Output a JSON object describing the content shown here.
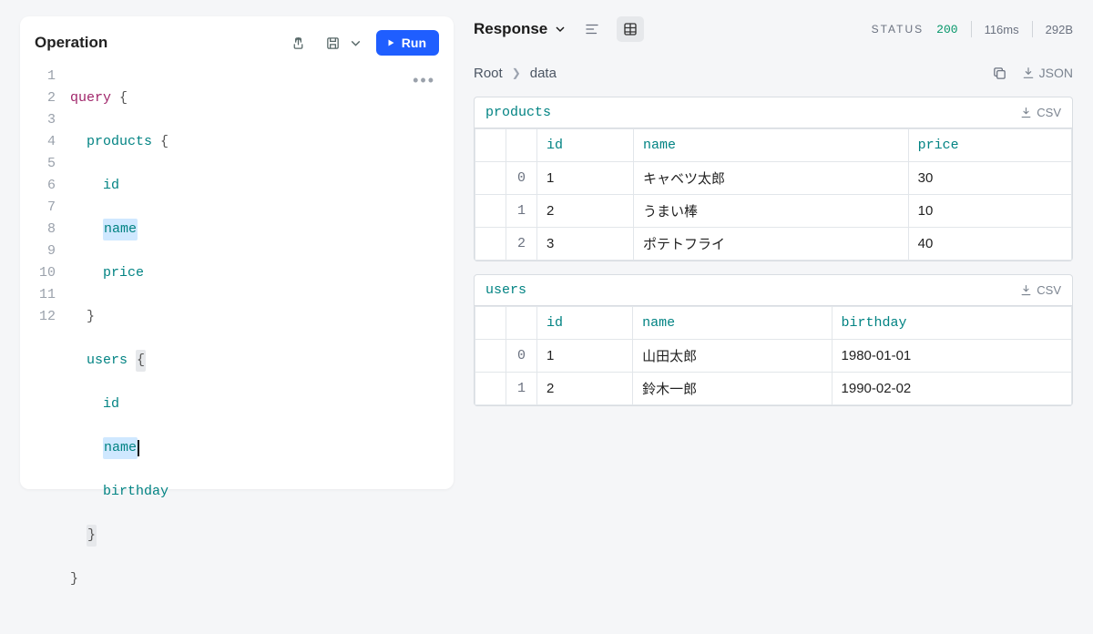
{
  "operation": {
    "title": "Operation",
    "run_label": "Run",
    "lines": [
      {
        "n": 1,
        "content": "query {",
        "cls": "kw"
      },
      {
        "n": 2,
        "content": "  products {",
        "cls": "fld"
      },
      {
        "n": 3,
        "content": "    id",
        "cls": "fld"
      },
      {
        "n": 4,
        "content": "    name",
        "cls": "fld hl"
      },
      {
        "n": 5,
        "content": "    price",
        "cls": "fld"
      },
      {
        "n": 6,
        "content": "  }",
        "cls": "brace"
      },
      {
        "n": 7,
        "content": "  users {",
        "cls": "fld bracehi"
      },
      {
        "n": 8,
        "content": "    id",
        "cls": "fld"
      },
      {
        "n": 9,
        "content": "    name",
        "cls": "fld hl cursor"
      },
      {
        "n": 10,
        "content": "    birthday",
        "cls": "fld"
      },
      {
        "n": 11,
        "content": "  }",
        "cls": "brace bracehi"
      },
      {
        "n": 12,
        "content": "}",
        "cls": "brace"
      }
    ],
    "code_raw": "query {\n  products {\n    id\n    name\n    price\n  }\n  users {\n    id\n    name\n    birthday\n  }\n}"
  },
  "response": {
    "title": "Response",
    "status_label": "STATUS",
    "status_code": "200",
    "latency": "116ms",
    "size": "292B",
    "json_label": "JSON",
    "csv_label": "CSV",
    "breadcrumb": {
      "root": "Root",
      "current": "data"
    },
    "sections": [
      {
        "name": "products",
        "columns": [
          "id",
          "name",
          "price"
        ],
        "rows": [
          {
            "idx": 0,
            "cells": [
              "1",
              "キャベツ太郎",
              "30"
            ]
          },
          {
            "idx": 1,
            "cells": [
              "2",
              "うまい棒",
              "10"
            ]
          },
          {
            "idx": 2,
            "cells": [
              "3",
              "ポテトフライ",
              "40"
            ]
          }
        ]
      },
      {
        "name": "users",
        "columns": [
          "id",
          "name",
          "birthday"
        ],
        "rows": [
          {
            "idx": 0,
            "cells": [
              "1",
              "山田太郎",
              "1980-01-01"
            ]
          },
          {
            "idx": 1,
            "cells": [
              "2",
              "鈴木一郎",
              "1990-02-02"
            ]
          }
        ]
      }
    ]
  }
}
